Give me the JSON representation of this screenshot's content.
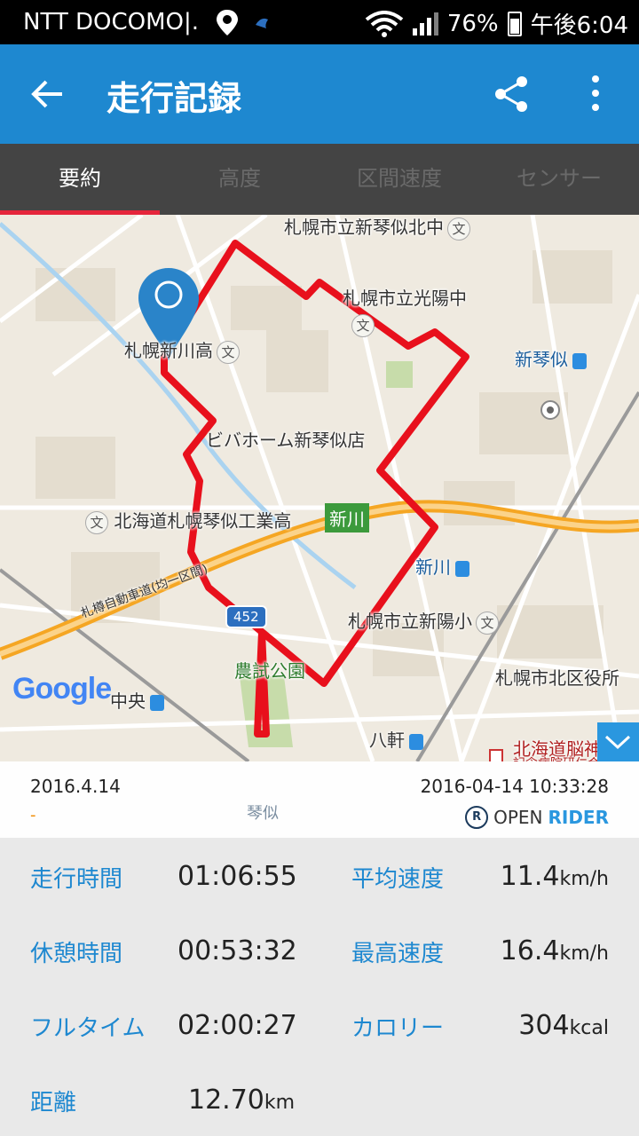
{
  "status_bar": {
    "carrier": "NTT DOCOMO|.",
    "battery": "76%",
    "time": "午後6:04"
  },
  "app_bar": {
    "title": "走行記録",
    "back_icon": "arrow-left-icon",
    "share_icon": "share-icon",
    "menu_icon": "more-vert-icon"
  },
  "tabs": [
    {
      "label": "要約",
      "active": true
    },
    {
      "label": "高度",
      "active": false
    },
    {
      "label": "区間速度",
      "active": false
    },
    {
      "label": "センサー",
      "active": false
    }
  ],
  "map": {
    "labels": {
      "l1": "札幌市立新琴似北中",
      "l2": "札幌市立光陽中",
      "l3": "新琴似",
      "l4": "札幌新川高",
      "l5": "ビバホーム新琴似店",
      "l6": "北海道札幌琴似工業高",
      "l7": "新川",
      "l8": "新川",
      "l9": "札樽自動車道(均一区間)",
      "l10": "札幌市立新陽小",
      "l11": "農試公園",
      "l12": "札幌市北区役所",
      "l13": "中央",
      "l14": "八軒",
      "l15": "北海道脳神経外",
      "l16": "記念病院研仁会",
      "l17": "琴似"
    },
    "route_shield": "452",
    "logo": "Google",
    "route_color": "#e8101c",
    "pin_color": "#2a84c9"
  },
  "summary": {
    "date": "2016.4.14",
    "dash": "-",
    "datetime": "2016-04-14 10:33:28",
    "brand_a": "OPEN",
    "brand_b": "RIDER"
  },
  "stats": {
    "riding_time_label": "走行時間",
    "riding_time": "01:06:55",
    "avg_speed_label": "平均速度",
    "avg_speed": "11.4",
    "avg_speed_unit": "km/h",
    "rest_time_label": "休憩時間",
    "rest_time": "00:53:32",
    "max_speed_label": "最高速度",
    "max_speed": "16.4",
    "max_speed_unit": "km/h",
    "full_time_label": "フルタイム",
    "full_time": "02:00:27",
    "calorie_label": "カロリー",
    "calorie": "304",
    "calorie_unit": "kcal",
    "distance_label": "距離",
    "distance": "12.70",
    "distance_unit": "km"
  }
}
